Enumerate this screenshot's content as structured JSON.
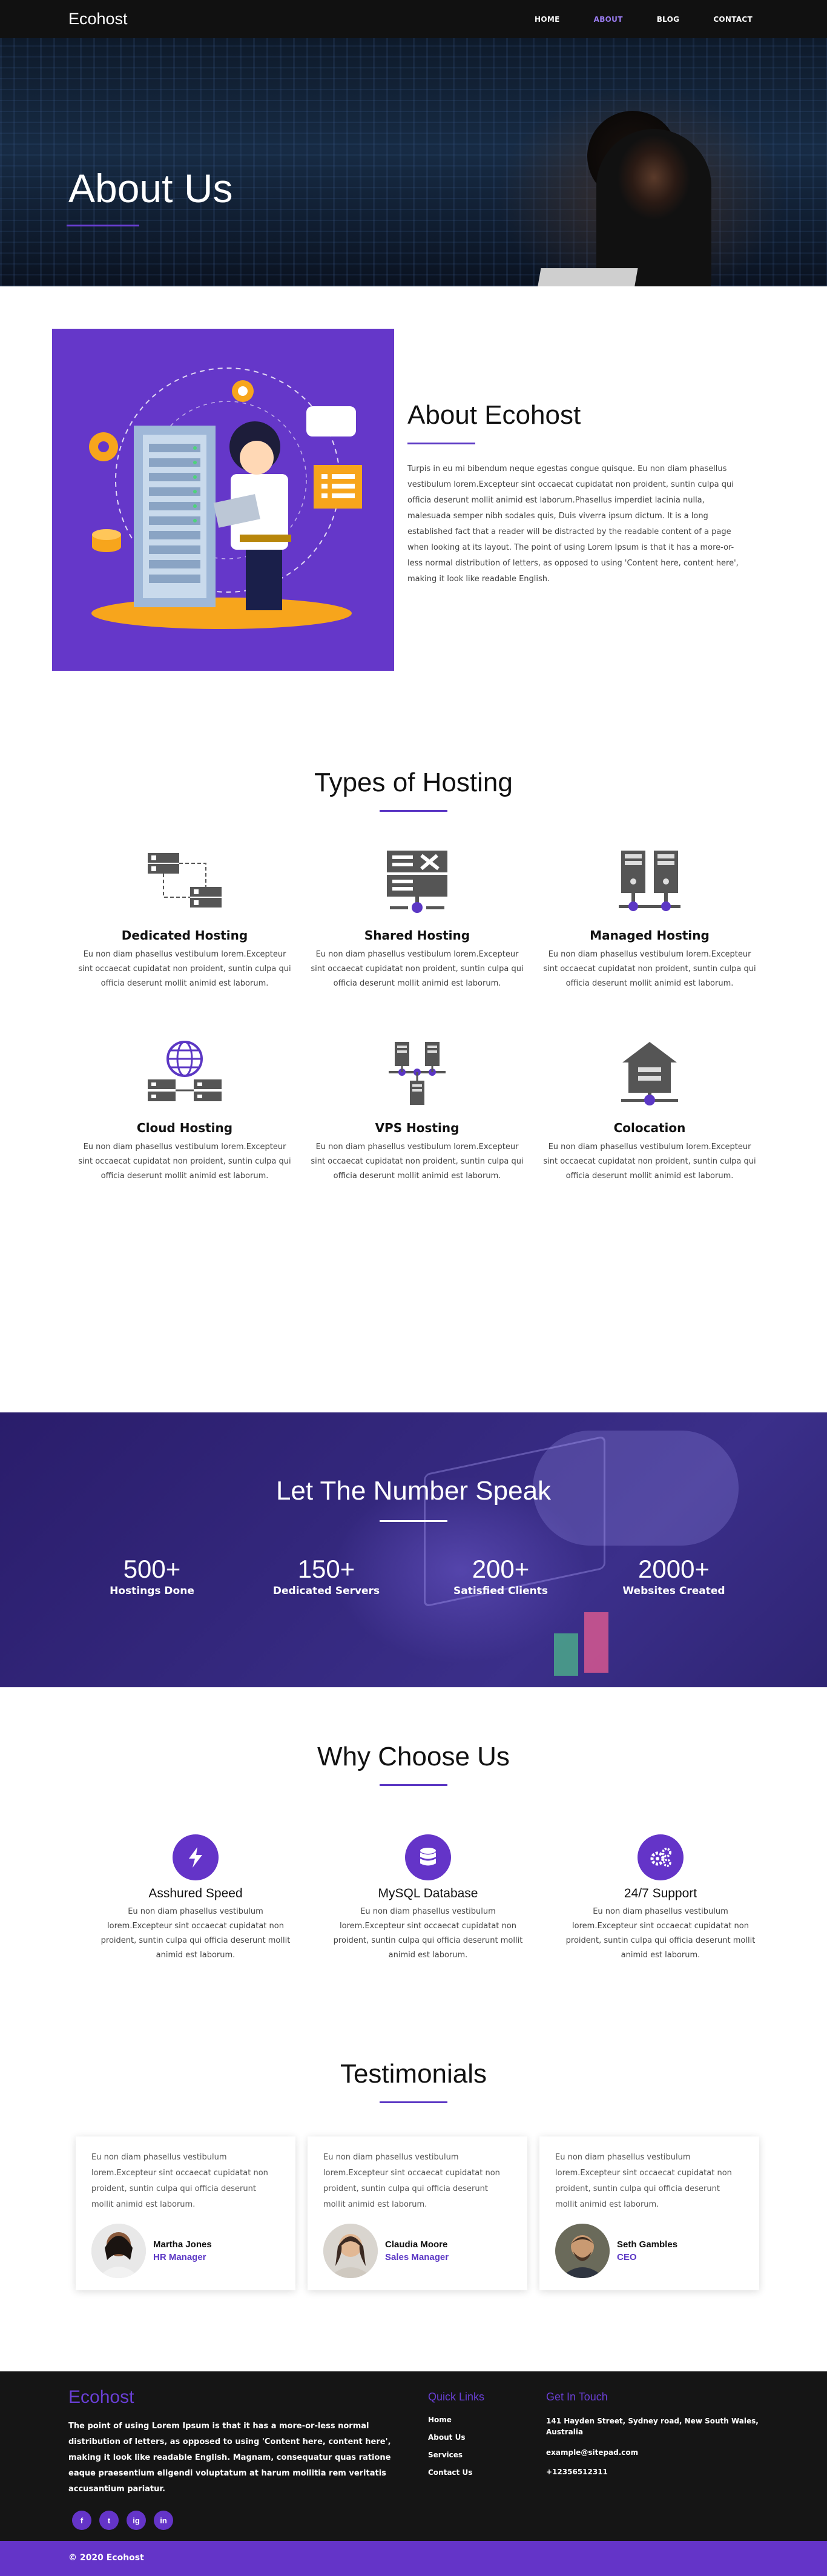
{
  "nav": {
    "brand": "Ecohost",
    "items": [
      {
        "label": "HOME",
        "active": false
      },
      {
        "label": "ABOUT",
        "active": true
      },
      {
        "label": "BLOG",
        "active": false
      },
      {
        "label": "CONTACT",
        "active": false
      }
    ]
  },
  "hero": {
    "title": "About Us"
  },
  "about": {
    "title": "About Ecohost",
    "text": "Turpis in eu mi bibendum neque egestas congue quisque. Eu non diam phasellus vestibulum lorem.Excepteur sint occaecat cupidatat non proident, suntin culpa qui officia deserunt mollit animid est laborum.Phasellus imperdiet lacinia nulla, malesuada semper nibh sodales quis, Duis viverra ipsum dictum. It is a long established fact that a reader will be distracted by the readable content of a page when looking at its layout. The point of using Lorem Ipsum is that it has a more-or-less normal distribution of letters, as opposed to using 'Content here, content here', making it look like readable English."
  },
  "types": {
    "title": "Types of Hosting",
    "items": [
      {
        "icon": "dedicated-hosting-icon",
        "title": "Dedicated Hosting",
        "text": "Eu non diam phasellus vestibulum lorem.Excepteur sint occaecat cupidatat non proident, suntin culpa qui officia deserunt mollit animid est laborum."
      },
      {
        "icon": "shared-hosting-icon",
        "title": "Shared Hosting",
        "text": "Eu non diam phasellus vestibulum lorem.Excepteur sint occaecat cupidatat non proident, suntin culpa qui officia deserunt mollit animid est laborum."
      },
      {
        "icon": "managed-hosting-icon",
        "title": "Managed Hosting",
        "text": "Eu non diam phasellus vestibulum lorem.Excepteur sint occaecat cupidatat non proident, suntin culpa qui officia deserunt mollit animid est laborum."
      },
      {
        "icon": "cloud-hosting-icon",
        "title": "Cloud Hosting",
        "text": "Eu non diam phasellus vestibulum lorem.Excepteur sint occaecat cupidatat non proident, suntin culpa qui officia deserunt mollit animid est laborum."
      },
      {
        "icon": "vps-hosting-icon",
        "title": "VPS Hosting",
        "text": "Eu non diam phasellus vestibulum lorem.Excepteur sint occaecat cupidatat non proident, suntin culpa qui officia deserunt mollit animid est laborum."
      },
      {
        "icon": "colocation-icon",
        "title": "Colocation",
        "text": "Eu non diam phasellus vestibulum lorem.Excepteur sint occaecat cupidatat non proident, suntin culpa qui officia deserunt mollit animid est laborum."
      }
    ]
  },
  "numbers": {
    "title": "Let The Number Speak",
    "stats": [
      {
        "value": "500+",
        "label": "Hostings Done"
      },
      {
        "value": "150+",
        "label": "Dedicated Servers"
      },
      {
        "value": "200+",
        "label": "Satisfied Clients"
      },
      {
        "value": "2000+",
        "label": "Websites Created"
      }
    ]
  },
  "why": {
    "title": "Why Choose Us",
    "items": [
      {
        "icon": "lightning-bolt-icon",
        "title": "Asshured Speed",
        "text": "Eu non diam phasellus vestibulum lorem.Excepteur sint occaecat cupidatat non proident, suntin culpa qui officia deserunt mollit animid est laborum."
      },
      {
        "icon": "database-icon",
        "title": "MySQL Database",
        "text": "Eu non diam phasellus vestibulum lorem.Excepteur sint occaecat cupidatat non proident, suntin culpa qui officia deserunt mollit animid est laborum."
      },
      {
        "icon": "gears-icon",
        "title": "24/7 Support",
        "text": "Eu non diam phasellus vestibulum lorem.Excepteur sint occaecat cupidatat non proident, suntin culpa qui officia deserunt mollit animid est laborum."
      }
    ]
  },
  "testimonials": {
    "title": "Testimonials",
    "items": [
      {
        "text": "Eu non diam phasellus vestibulum lorem.Excepteur sint occaecat cupidatat non proident, suntin culpa qui officia deserunt mollit animid est laborum.",
        "name": "Martha Jones",
        "role": "HR Manager"
      },
      {
        "text": "Eu non diam phasellus vestibulum lorem.Excepteur sint occaecat cupidatat non proident, suntin culpa qui officia deserunt mollit animid est laborum.",
        "name": "Claudia Moore",
        "role": "Sales Manager"
      },
      {
        "text": "Eu non diam phasellus vestibulum lorem.Excepteur sint occaecat cupidatat non proident, suntin culpa qui officia deserunt mollit animid est laborum.",
        "name": "Seth Gambles",
        "role": "CEO"
      }
    ]
  },
  "footer": {
    "brand": "Ecohost",
    "about": "The point of using Lorem Ipsum is that it has a more-or-less normal distribution of letters, as opposed to using 'Content here, content here', making it look like readable English. Magnam, consequatur quas ratione eaque praesentium eligendi voluptatum at harum mollitia rem veritatis accusantium pariatur.",
    "socials": [
      "f",
      "t",
      "ig",
      "in"
    ],
    "links_heading": "Quick Links",
    "links": [
      "Home",
      "About Us",
      "Services",
      "Contact Us"
    ],
    "contact_heading": "Get In Touch",
    "address": "141 Hayden Street, Sydney road, New South Wales, Australia",
    "email": "example@sitepad.com",
    "phone": "+12356512311",
    "copyright": "© 2020 Ecohost"
  },
  "colors": {
    "accent": "#6434c8",
    "nav_active": "#9a7cf0",
    "footer_bg": "#151515"
  }
}
